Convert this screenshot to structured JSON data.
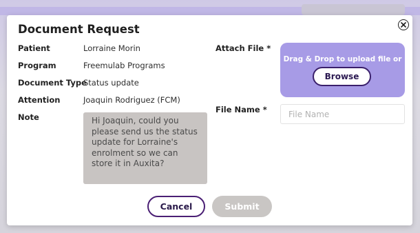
{
  "dialog": {
    "title": "Document Request"
  },
  "fields": {
    "patient": {
      "label": "Patient",
      "value": "Lorraine Morin"
    },
    "program": {
      "label": "Program",
      "value": "Freemulab Programs"
    },
    "document_type": {
      "label": "Document Type",
      "value": "Status update"
    },
    "attention": {
      "label": "Attention",
      "value": "Joaquin Rodriguez (FCM)"
    },
    "note": {
      "label": "Note",
      "value": "Hi Joaquin, could you please send us the status update for Lorraine's enrolment so we can store it in Auxita?"
    }
  },
  "attach": {
    "label": "Attach File *",
    "dropzone_text": "Drag & Drop to upload file or",
    "browse_label": "Browse"
  },
  "file_name": {
    "label": "File Name *",
    "placeholder": "File Name",
    "value": ""
  },
  "actions": {
    "cancel_label": "Cancel",
    "submit_label": "Submit"
  },
  "colors": {
    "dropzone": "#a79be6",
    "primary_border": "#4a1f74",
    "submit_disabled": "#c9c6c4",
    "note_bg": "#c8c4c2"
  },
  "icons": {
    "close": "close-icon"
  }
}
